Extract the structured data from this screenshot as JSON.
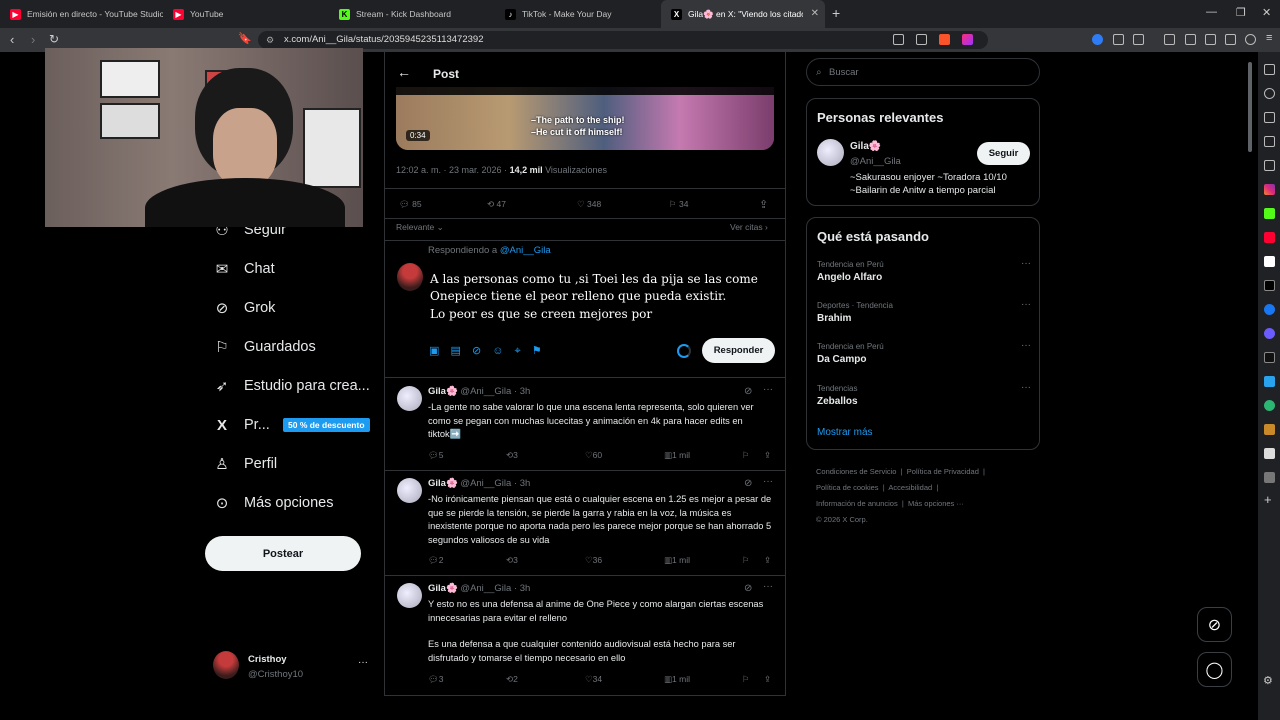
{
  "browser": {
    "tabs": [
      {
        "label": "Emisión en directo - YouTube Studio",
        "icon": "youtube-studio-icon",
        "color": "#ff0033"
      },
      {
        "label": "YouTube",
        "icon": "youtube-icon",
        "color": "#ff0033"
      },
      {
        "label": "Stream - Kick Dashboard",
        "icon": "kick-icon",
        "color": "#53fc18"
      },
      {
        "label": "TikTok - Make Your Day",
        "icon": "tiktok-icon",
        "color": "#ffffff"
      },
      {
        "label": "Gila🌸 en X: \"Viendo los citado",
        "icon": "x-icon",
        "color": "#ffffff"
      }
    ],
    "url": "x.com/Ani__Gila/status/2035945235113472392"
  },
  "nav": {
    "items": [
      {
        "label": "Seguir",
        "icon": "follow-icon"
      },
      {
        "label": "Chat",
        "icon": "mail-icon"
      },
      {
        "label": "Grok",
        "icon": "grok-icon"
      },
      {
        "label": "Guardados",
        "icon": "bookmark-icon"
      },
      {
        "label": "Estudio para crea...",
        "icon": "rocket-icon"
      },
      {
        "label": "Pr...",
        "icon": "x-logo-icon"
      },
      {
        "label": "Perfil",
        "icon": "person-icon"
      },
      {
        "label": "Más opciones",
        "icon": "more-circle-icon"
      }
    ],
    "discount_badge": "50 % de descuento",
    "post_button": "Postear",
    "account": {
      "name": "Cristhoy",
      "handle": "@Cristhoy10",
      "more": "···"
    }
  },
  "center": {
    "header_title": "Post",
    "video": {
      "duration": "0:34",
      "subtitle1": "–The path to the ship!",
      "subtitle2": "–He cut it off himself!"
    },
    "timestamp": "12:02 a. m. · 23 mar. 2026 · ",
    "views_count": "14,2 mil",
    "views_label": " Visualizaciones",
    "stats": {
      "replies": "85",
      "reposts": "47",
      "likes": "348",
      "bookmarks": "34"
    },
    "sort_label": "Relevante",
    "quotes_label": "Ver citas",
    "replying_prefix": "Respondiendo a ",
    "replying_handle": "@Ani__Gila",
    "draft_lines": [
      "A las personas como tu ,si Toei les da pija se las come",
      "Onepiece tiene el peor  relleno que pueda existir.",
      "Lo peor es que se creen mejores por"
    ],
    "respond_button": "Responder",
    "replies": [
      {
        "name": "Gila🌸",
        "handle": "@Ani__Gila · 3h",
        "body": "-La gente no sabe valorar lo que una escena lenta representa, solo quieren ver como se pegan con muchas lucecitas y animación en 4k para hacer edits en tiktok➡️",
        "replies": "5",
        "reposts": "3",
        "likes": "60",
        "views": "1 mil"
      },
      {
        "name": "Gila🌸",
        "handle": "@Ani__Gila · 3h",
        "body": "-No irónicamente piensan que está o cualquier escena en 1.25 es mejor a pesar de que se pierde la tensión, se pierde la garra y rabia en la voz, la música es inexistente porque no aporta nada pero les parece mejor porque se han ahorrado 5 segundos valiosos de su vida",
        "replies": "2",
        "reposts": "3",
        "likes": "36",
        "views": "1 mil"
      },
      {
        "name": "Gila🌸",
        "handle": "@Ani__Gila · 3h",
        "body": "Y esto no es una defensa al anime de One Piece y como alargan ciertas escenas innecesarias para evitar el relleno",
        "body2": "Es una defensa a que cualquier contenido audiovisual está hecho para ser disfrutado y tomarse el tiempo necesario en ello",
        "replies": "3",
        "reposts": "2",
        "likes": "34",
        "views": "1 mil"
      }
    ]
  },
  "right": {
    "search_placeholder": "Buscar",
    "relevant_title": "Personas relevantes",
    "person": {
      "name": "Gila🌸",
      "handle": "@Ani__Gila",
      "follow": "Seguir",
      "bio1": "~Sakurasou enjoyer ~Toradora 10/10",
      "bio2": "~Bailarin de Anitw a tiempo parcial"
    },
    "trends_title": "Qué está pasando",
    "trends": [
      {
        "context": "Tendencia en Perú",
        "name": "Angelo Alfaro"
      },
      {
        "context": "Deportes · Tendencia",
        "name": "Brahim"
      },
      {
        "context": "Tendencia en Perú",
        "name": "Da Campo"
      },
      {
        "context": "Tendencias",
        "name": "Zeballos"
      }
    ],
    "show_more": "Mostrar más",
    "footer": {
      "l1a": "Condiciones de Servicio",
      "l1b": "Política de Privacidad",
      "l2a": "Política de cookies",
      "l2b": "Accesibilidad",
      "l3a": "Información de anuncios",
      "l3b": "Más opciones ···",
      "copyright": "© 2026 X Corp."
    }
  },
  "colors": {
    "accent": "#1d9bf0",
    "text": "#e7e9ea",
    "muted": "#71767b",
    "border": "#2f3336"
  }
}
